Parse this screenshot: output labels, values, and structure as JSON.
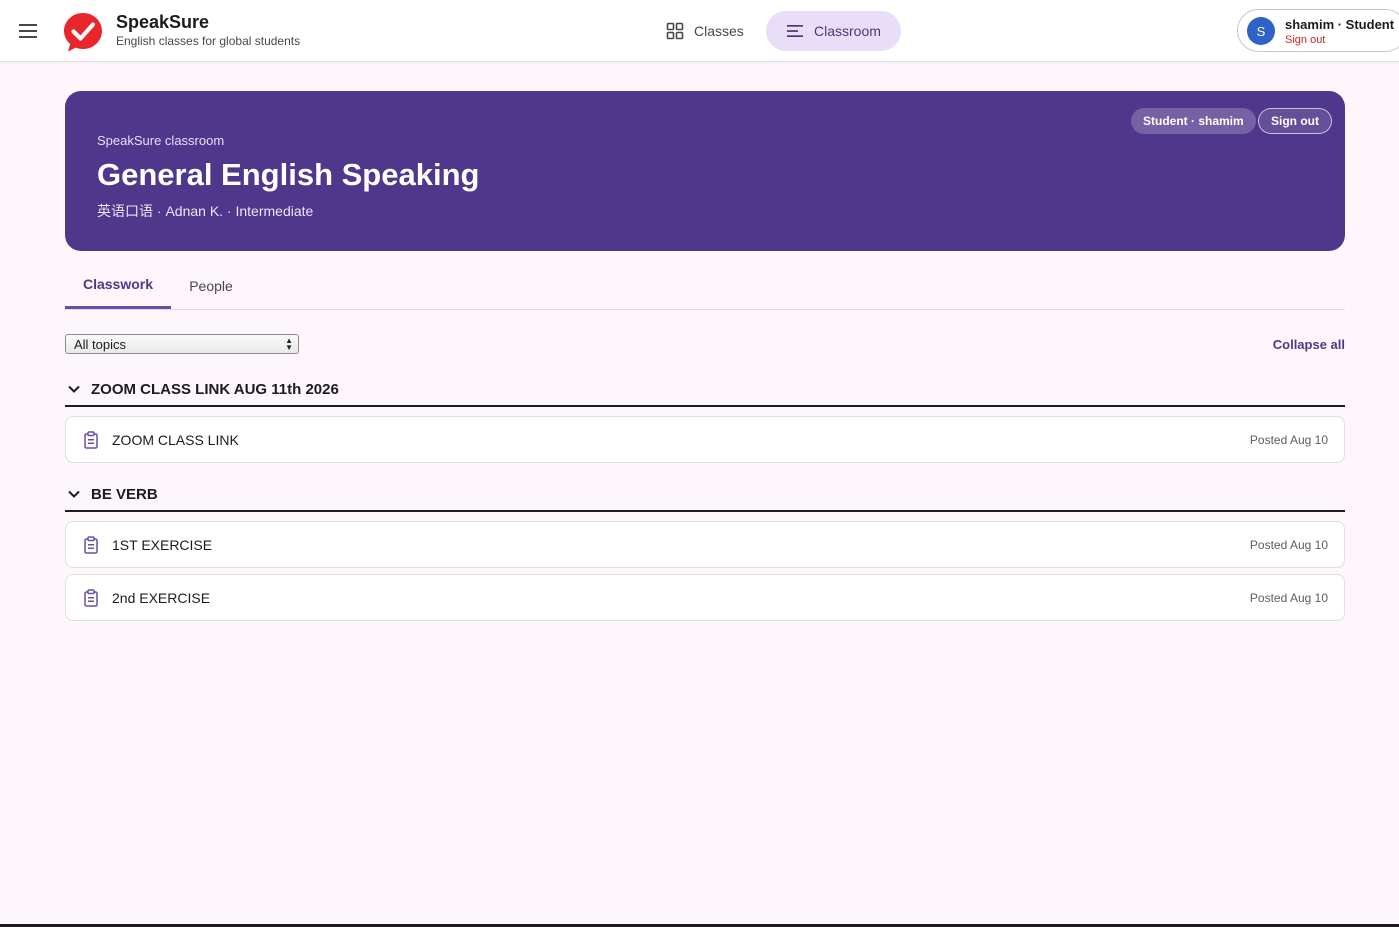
{
  "app": {
    "name": "SpeakSure",
    "tagline": "English classes for global students"
  },
  "nav": {
    "classes_label": "Classes",
    "classroom_label": "Classroom"
  },
  "user": {
    "avatar_initial": "S",
    "display": "shamim · Student",
    "signout_label": "Sign out"
  },
  "hero": {
    "kicker": "SpeakSure classroom",
    "title": "General English Speaking",
    "subtitle": "英语口语 · Adnan K. · Intermediate",
    "role_pill": "Student · shamim",
    "signout_label": "Sign out",
    "color": "#4f378b"
  },
  "tabs": [
    {
      "label": "Classwork",
      "active": true
    },
    {
      "label": "People",
      "active": false
    }
  ],
  "toolbar": {
    "topic_filter_value": "All topics",
    "collapse_label": "Collapse all"
  },
  "topics": [
    {
      "title": "ZOOM CLASS LINK AUG 11th 2026",
      "items": [
        {
          "title": "ZOOM CLASS LINK",
          "date": "Posted Aug 10"
        }
      ]
    },
    {
      "title": "BE VERB",
      "items": [
        {
          "title": "1ST EXERCISE",
          "date": "Posted Aug 10"
        },
        {
          "title": "2nd EXERCISE",
          "date": "Posted Aug 10"
        }
      ]
    }
  ],
  "icons": {
    "menu": "hamburger-menu-icon",
    "logo": "check-bubble-logo",
    "classes": "grid-icon",
    "classroom": "list-icon",
    "topic_toggle": "chevron-down-icon",
    "assignment": "clipboard-icon"
  }
}
